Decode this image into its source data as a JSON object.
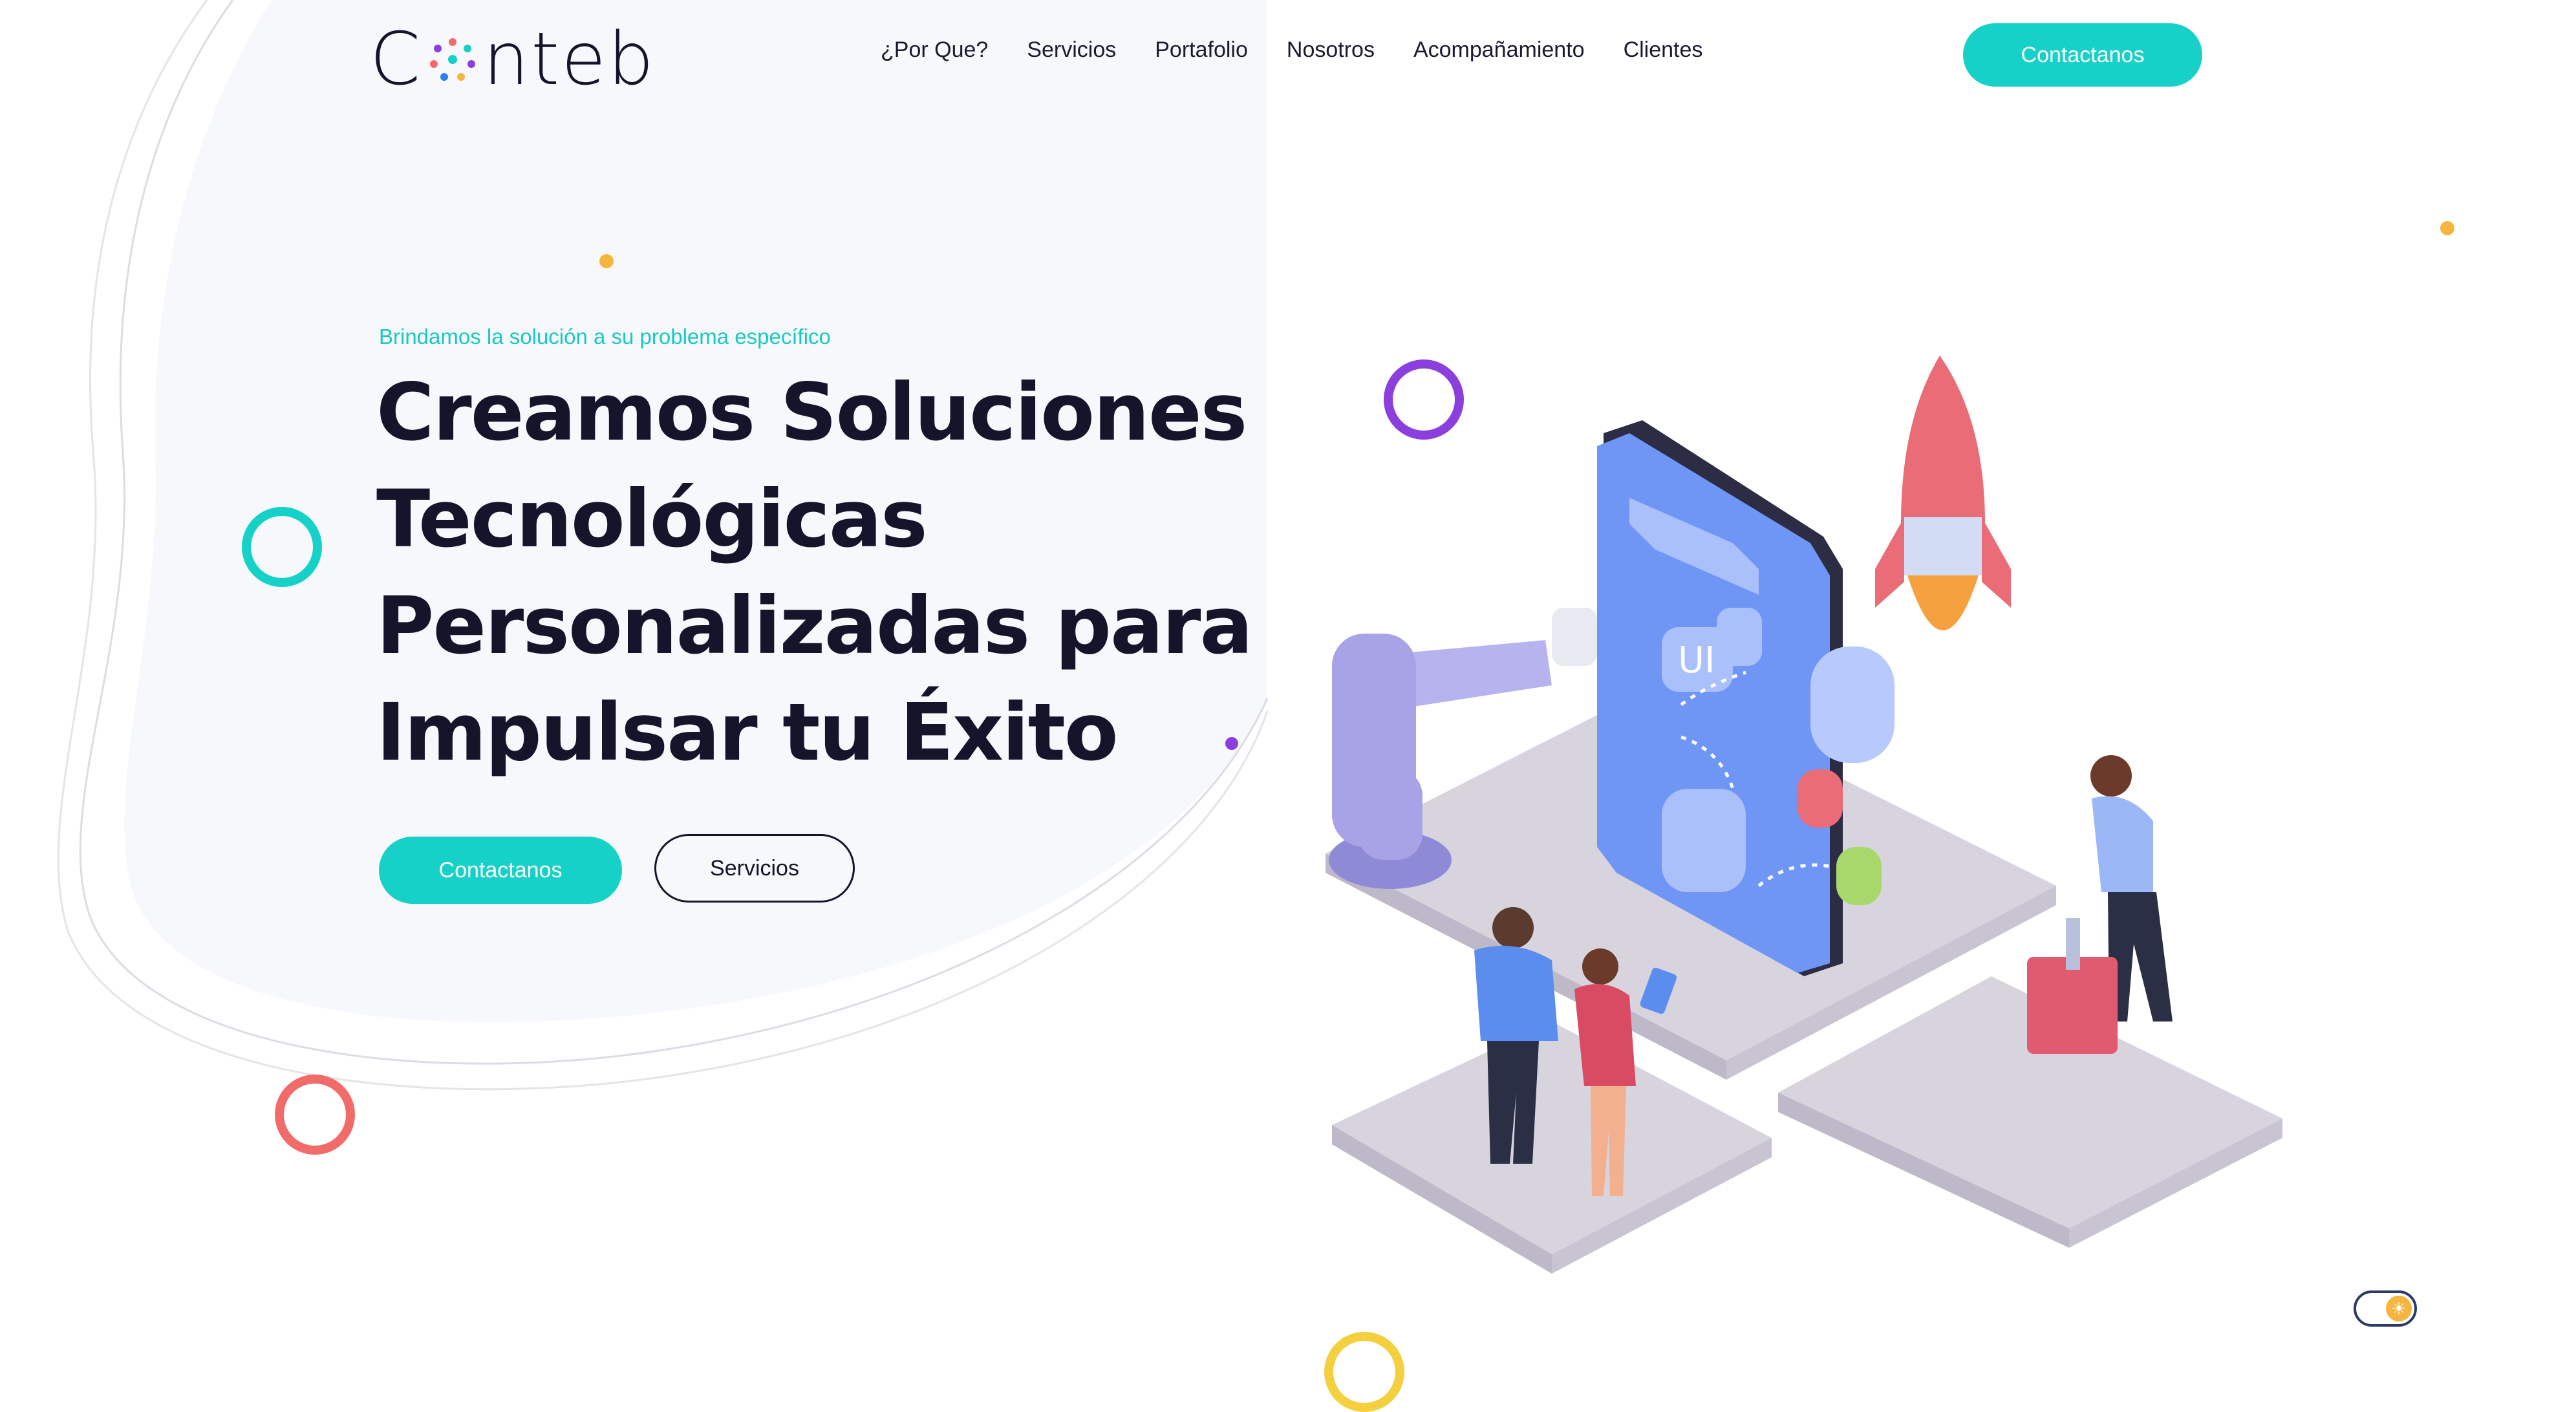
{
  "brand": {
    "logo_left": "C",
    "logo_right": "nteb"
  },
  "nav": {
    "items": [
      {
        "label": "¿Por Que?"
      },
      {
        "label": "Servicios"
      },
      {
        "label": "Portafolio"
      },
      {
        "label": "Nosotros"
      },
      {
        "label": "Acompañamiento"
      },
      {
        "label": "Clientes"
      }
    ],
    "cta_label": "Contactanos"
  },
  "hero": {
    "tagline": "Brindamos la solución a su problema específico",
    "title": "Creamos Soluciones Tecnológicas Personalizadas para Impulsar tu Éxito",
    "primary_button": "Contactanos",
    "secondary_button": "Servicios",
    "illustration_label": "UI"
  },
  "colors": {
    "accent": "#16d1c7",
    "text_dark": "#14142b",
    "purple": "#8b3fdc",
    "coral": "#f26b6b",
    "yellow": "#f4b63f",
    "blob_bg": "#f7f8fc"
  },
  "icons": {
    "theme_toggle": "sun-icon"
  }
}
